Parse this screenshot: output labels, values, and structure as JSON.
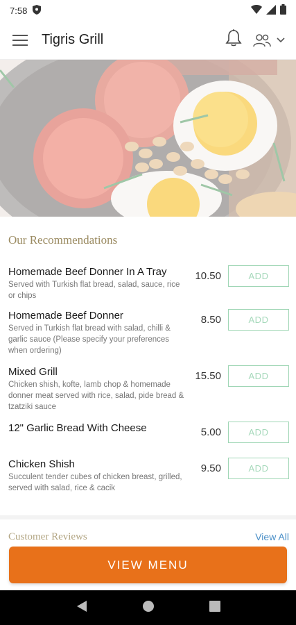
{
  "status_bar": {
    "time": "7:58"
  },
  "header": {
    "title": "Tigris Grill"
  },
  "recommendations": {
    "title": "Our Recommendations",
    "items": [
      {
        "name": "Homemade Beef Donner In A Tray",
        "description": "Served with Turkish flat bread, salad, sauce, rice or chips",
        "price": "10.50",
        "add_label": "ADD"
      },
      {
        "name": "Homemade Beef Donner",
        "description": "Served in Turkish flat bread with salad, chilli & garlic sauce (Please specify your preferences when ordering)",
        "price": "8.50",
        "add_label": "ADD"
      },
      {
        "name": "Mixed Grill",
        "description": "Chicken shish, kofte, lamb chop & homemade donner meat served with rice, salad, pide bread & tzatziki sauce",
        "price": "15.50",
        "add_label": "ADD"
      },
      {
        "name": "12\" Garlic Bread With Cheese",
        "description": "",
        "price": "5.00",
        "add_label": "ADD"
      },
      {
        "name": "Chicken Shish",
        "description": "Succulent tender cubes of chicken breast, grilled, served with salad, rice & cacik",
        "price": "9.50",
        "add_label": "ADD"
      }
    ]
  },
  "reviews": {
    "title": "Customer Reviews",
    "view_all": "View All"
  },
  "view_menu_label": "VIEW MENU",
  "colors": {
    "accent": "#e8711a",
    "add_border": "#9fd6b5",
    "section_title": "#9a8a60",
    "link": "#4a8fc7"
  }
}
